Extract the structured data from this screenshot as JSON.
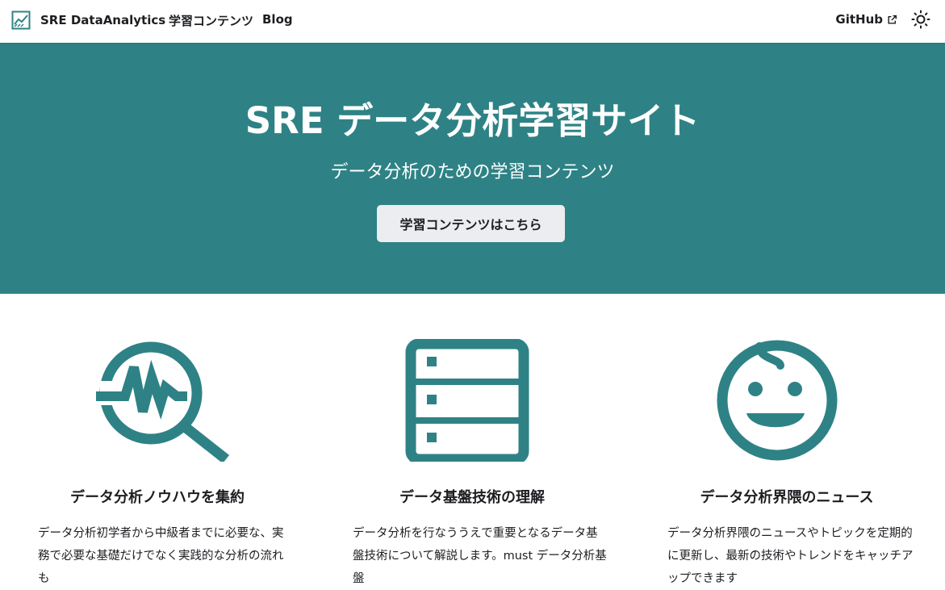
{
  "navbar": {
    "brand_title": "SRE DataAnalytics",
    "brand_icon": "line-chart-logo-icon",
    "links": [
      "学習コンテンツ",
      "Blog"
    ],
    "github_label": "GitHub",
    "theme_icon": "sun-icon"
  },
  "hero": {
    "title": "SRE データ分析学習サイト",
    "subtitle": "データ分析のための学習コンテンツ",
    "button_label": "学習コンテンツはこちら"
  },
  "features": [
    {
      "icon": "magnifier-pulse-icon",
      "title": "データ分析ノウハウを集約",
      "description": "データ分析初学者から中級者までに必要な、実務で必要な基礎だけでなく実践的な分析の流れも"
    },
    {
      "icon": "server-stack-icon",
      "title": "データ基盤技術の理解",
      "description": "データ分析を行なううえで重要となるデータ基盤技術について解説します。must データ分析基盤"
    },
    {
      "icon": "baby-face-icon",
      "title": "データ分析界隈のニュース",
      "description": "データ分析界隈のニュースやトピックを定期的に更新し、最新の技術やトレンドをキャッチアップできます"
    }
  ],
  "colors": {
    "primary": "#2e8285",
    "button_bg": "#ebedf0",
    "text": "#1c1e21"
  }
}
